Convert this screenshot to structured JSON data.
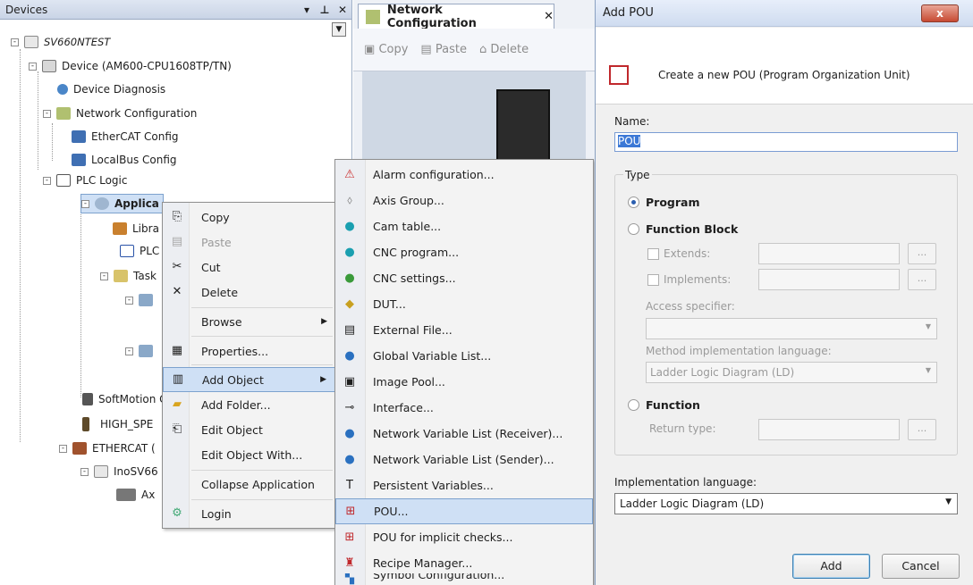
{
  "devices": {
    "title": "Devices",
    "tree": {
      "project": "SV660NTEST",
      "device": "Device (AM600-CPU1608TP/TN)",
      "diagnosis": "Device Diagnosis",
      "network": "Network Configuration",
      "ethercat_config": "EtherCAT Config",
      "localbus_config": "LocalBus Config",
      "plc_logic": "PLC Logic",
      "application": "Applica",
      "library": "Libra",
      "plc_prg": "PLC",
      "task": "Task",
      "softmotion": "SoftMotion G",
      "high_spe": "HIGH_SPE",
      "ethercat": "ETHERCAT (",
      "inosv": "InoSV66",
      "axis": "Ax"
    }
  },
  "network_tab": {
    "title": "Network Configuration",
    "toolbar": {
      "copy": "Copy",
      "paste": "Paste",
      "delete": "Delete"
    }
  },
  "context_menu": {
    "items": [
      {
        "label": "Copy"
      },
      {
        "label": "Paste"
      },
      {
        "label": "Cut"
      },
      {
        "label": "Delete"
      },
      {
        "label": "Browse"
      },
      {
        "label": "Properties..."
      },
      {
        "label": "Add Object"
      },
      {
        "label": "Add Folder..."
      },
      {
        "label": "Edit Object"
      },
      {
        "label": "Edit Object With..."
      },
      {
        "label": "Collapse Application"
      },
      {
        "label": "Login"
      }
    ]
  },
  "submenu": {
    "items": [
      {
        "label": "Alarm configuration..."
      },
      {
        "label": "Axis Group..."
      },
      {
        "label": "Cam table..."
      },
      {
        "label": "CNC program..."
      },
      {
        "label": "CNC settings..."
      },
      {
        "label": "DUT..."
      },
      {
        "label": "External File..."
      },
      {
        "label": "Global Variable List..."
      },
      {
        "label": "Image Pool..."
      },
      {
        "label": "Interface..."
      },
      {
        "label": "Network Variable List (Receiver)..."
      },
      {
        "label": "Network Variable List (Sender)..."
      },
      {
        "label": "Persistent Variables..."
      },
      {
        "label": "POU..."
      },
      {
        "label": "POU for implicit checks..."
      },
      {
        "label": "Recipe Manager..."
      },
      {
        "label": "Symbol Configuration..."
      }
    ]
  },
  "dialog": {
    "title": "Add POU",
    "close": "x",
    "header": "Create a new POU (Program Organization Unit)",
    "name_label": "Name:",
    "name_value": "POU",
    "type_label": "Type",
    "program": "Program",
    "function_block": "Function Block",
    "extends": "Extends:",
    "implements": "Implements:",
    "access_label": "Access specifier:",
    "method_lang_label": "Method implementation language:",
    "method_lang_value": "Ladder Logic Diagram (LD)",
    "function": "Function",
    "return_type": "Return type:",
    "impl_lang_label": "Implementation language:",
    "impl_lang_value": "Ladder Logic Diagram (LD)",
    "add": "Add",
    "cancel": "Cancel",
    "ellipsis": "..."
  }
}
